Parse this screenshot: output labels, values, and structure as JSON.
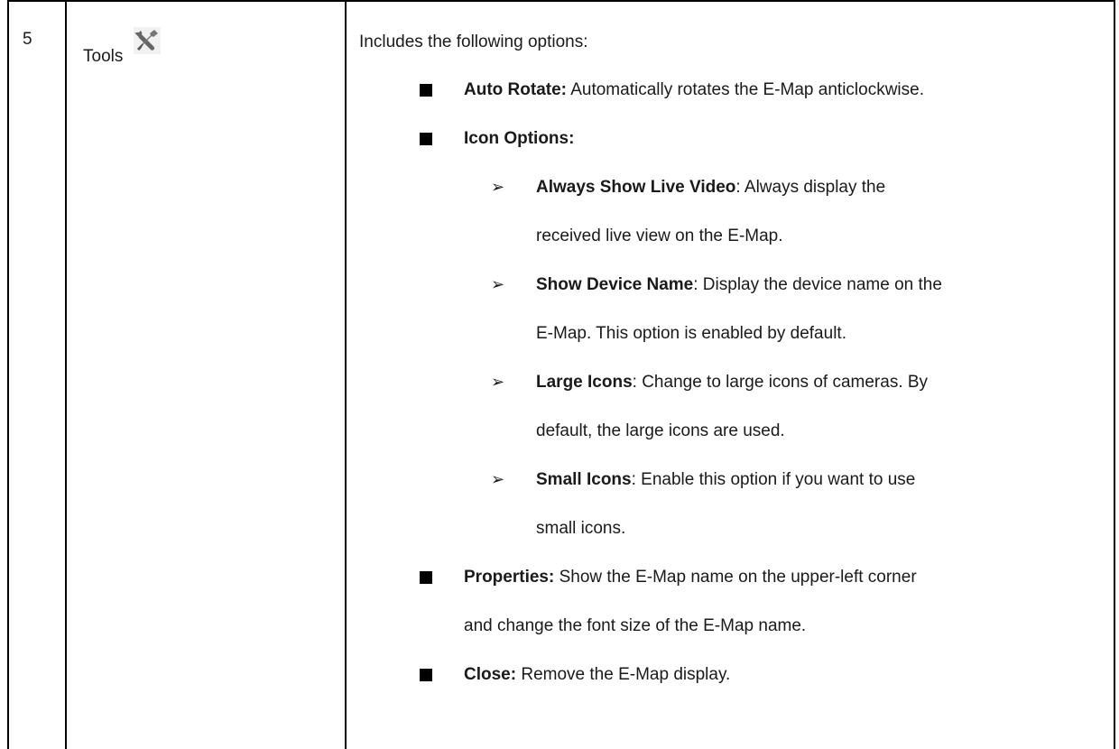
{
  "row": {
    "number": "5",
    "tool_label": "Tools",
    "tool_icon": "tools-icon",
    "intro": "Includes the following options:",
    "options": [
      {
        "title": "Auto Rotate:",
        "desc": " Automatically rotates the E-Map anticlockwise."
      },
      {
        "title": "Icon Options:",
        "desc": ""
      },
      {
        "title": "Properties:",
        "desc_line1": " Show the E-Map name on the upper-left corner",
        "desc_line2": "and change the font size of the E-Map name."
      },
      {
        "title": "Close:",
        "desc": " Remove the E-Map display."
      }
    ],
    "icon_options": [
      {
        "title": "Always Show Live Video",
        "line1": ": Always display the",
        "line2": "received live view on the E-Map."
      },
      {
        "title": "Show Device Name",
        "line1": ": Display the device name on the",
        "line2": "E-Map. This option is enabled by default."
      },
      {
        "title": "Large Icons",
        "line1": ": Change to large icons of cameras. By",
        "line2": "default, the large icons are used."
      },
      {
        "title": "Small Icons",
        "line1": ": Enable this option if you want to use",
        "line2": "small icons."
      }
    ]
  }
}
